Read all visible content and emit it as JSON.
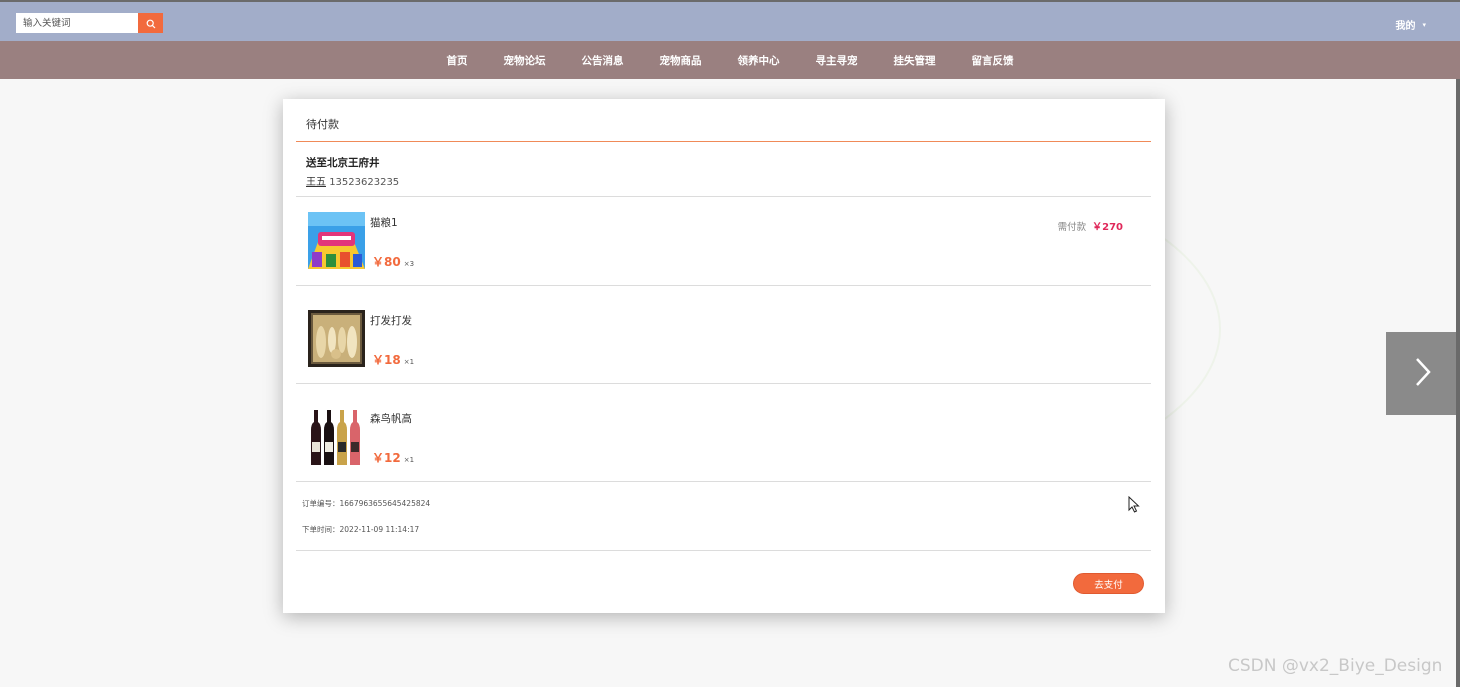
{
  "search": {
    "placeholder": "输入关键词",
    "icon": "search-icon"
  },
  "header": {
    "mine_label": "我的",
    "mine_caret": "▾"
  },
  "nav": {
    "items": [
      "首页",
      "宠物论坛",
      "公告消息",
      "宠物商品",
      "领养中心",
      "寻主寻宠",
      "挂失管理",
      "留言反馈"
    ]
  },
  "order": {
    "status_title": "待付款",
    "address": "送至北京王府井",
    "contact_name": "王五",
    "contact_phone": "13523623235",
    "need_pay_label": "需付款",
    "need_pay_amount": "￥270",
    "items": [
      {
        "name": "猫粮1",
        "price": "￥80",
        "qty": "×3"
      },
      {
        "name": "打发打发",
        "price": "￥18",
        "qty": "×1"
      },
      {
        "name": "森鸟帆高",
        "price": "￥12",
        "qty": "×1"
      }
    ],
    "order_no": "订单编号：1667963655645425824",
    "order_time": "下单时间：2022-11-09 11:14:17",
    "pay_button": "去支付"
  },
  "watermark": "CSDN @vx2_Biye_Design",
  "colors": {
    "accent": "#f26a3d",
    "topbar": "#a2adc9",
    "nav": "#9a8080",
    "price_need": "#e0285a"
  }
}
